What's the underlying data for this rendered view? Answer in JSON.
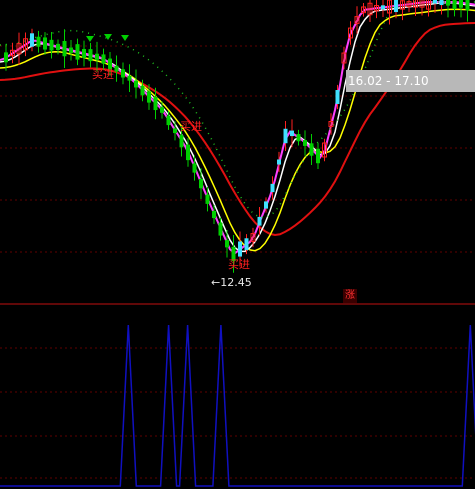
{
  "chart": {
    "tooltip_range": "16.02 - 17.10",
    "low_marker": "12.45",
    "buy_labels": [
      "买进",
      "买进",
      "买进"
    ],
    "rise_badge": "涨"
  },
  "colors": {
    "background": "#000000",
    "up_candle": "#ff2020",
    "up_candle_cyan": "#40e0ff",
    "down_candle": "#00d000",
    "ma_white": "#ffffff",
    "ma_yellow": "#ffff00",
    "ma_magenta": "#ff40ff",
    "ma_red": "#e01010",
    "ma_green_dotted": "#20c020",
    "indicator_line": "#1010c0",
    "grid": "#600000",
    "separator": "#c01010"
  },
  "indicator": {
    "spike_positions": [
      0.27,
      0.355,
      0.395,
      0.465,
      0.99
    ]
  }
}
